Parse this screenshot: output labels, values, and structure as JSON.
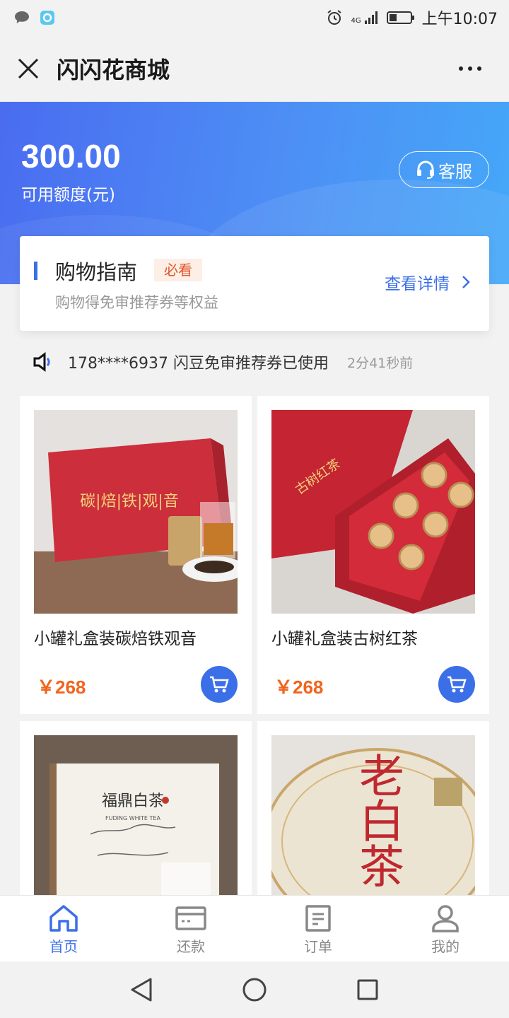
{
  "status_bar": {
    "time": "上午10:07",
    "network": "4G",
    "icons": [
      "chat-bubble-icon",
      "app-notification-icon",
      "alarm-icon",
      "signal-icon",
      "battery-icon"
    ]
  },
  "header": {
    "title": "闪闪花商城",
    "close_icon": "close-icon",
    "more_icon": "more-dots-icon"
  },
  "hero": {
    "amount": "300.00",
    "amount_label": "可用额度(元)",
    "service_label": "客服",
    "colors": {
      "gradient_start": "#4a6cf0",
      "gradient_end": "#45a8f8"
    }
  },
  "guide": {
    "title": "购物指南",
    "badge": "必看",
    "subtitle": "购物得免审推荐券等权益",
    "link_label": "查看详情"
  },
  "notice": {
    "text": "178****6937 闪豆免审推荐券已使用",
    "time": "2分41秒前"
  },
  "products": [
    {
      "name": "小罐礼盒装碳焙铁观音",
      "price": "￥268",
      "image_text": "碳|焙|铁|观|音"
    },
    {
      "name": "小罐礼盒装古树红茶",
      "price": "￥268",
      "image_text": "古树红茶"
    },
    {
      "name": "",
      "price": "",
      "image_text": "福鼎白茶",
      "image_subtext": "FUDING WHITE TEA"
    },
    {
      "name": "",
      "price": "",
      "image_text": "老白茶"
    }
  ],
  "tabs": [
    {
      "label": "首页",
      "icon": "home-icon",
      "active": true
    },
    {
      "label": "还款",
      "icon": "card-icon",
      "active": false
    },
    {
      "label": "订单",
      "icon": "document-icon",
      "active": false
    },
    {
      "label": "我的",
      "icon": "user-icon",
      "active": false
    }
  ],
  "accent_color": "#3b6fe8",
  "price_color": "#f0651d"
}
